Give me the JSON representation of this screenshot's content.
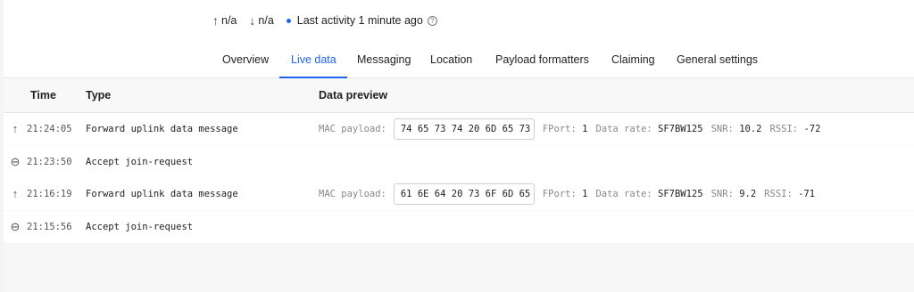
{
  "status": {
    "uplink": "n/a",
    "downlink": "n/a",
    "activity": "Last activity 1 minute ago"
  },
  "tabs": [
    {
      "label": "Overview"
    },
    {
      "label": "Live data",
      "active": true
    },
    {
      "label": "Messaging"
    },
    {
      "label": "Location"
    },
    {
      "label": "Payload formatters"
    },
    {
      "label": "Claiming"
    },
    {
      "label": "General settings"
    }
  ],
  "table": {
    "headers": {
      "time": "Time",
      "type": "Type",
      "preview": "Data preview"
    },
    "rows": [
      {
        "icon": "uplink-arrow-icon",
        "time": "21:24:05",
        "type": "Forward uplink data message",
        "mac_label": "MAC payload:",
        "mac_payload": "74 65 73 74 20 6D 65 73 ...",
        "fport_label": "FPort:",
        "fport": "1",
        "rate_label": "Data rate:",
        "rate": "SF7BW125",
        "snr_label": "SNR:",
        "snr": "10.2",
        "rssi_label": "RSSI:",
        "rssi": "-72"
      },
      {
        "icon": "link-icon",
        "time": "21:23:50",
        "type": "Accept join-request"
      },
      {
        "icon": "uplink-arrow-icon",
        "time": "21:16:19",
        "type": "Forward uplink data message",
        "mac_label": "MAC payload:",
        "mac_payload": "61 6E 64 20 73 6F 6D 65 ...",
        "fport_label": "FPort:",
        "fport": "1",
        "rate_label": "Data rate:",
        "rate": "SF7BW125",
        "snr_label": "SNR:",
        "snr": "9.2",
        "rssi_label": "RSSI:",
        "rssi": "-71"
      },
      {
        "icon": "link-icon",
        "time": "21:15:56",
        "type": "Accept join-request"
      }
    ]
  },
  "colors": {
    "accent": "#1e63e9"
  }
}
